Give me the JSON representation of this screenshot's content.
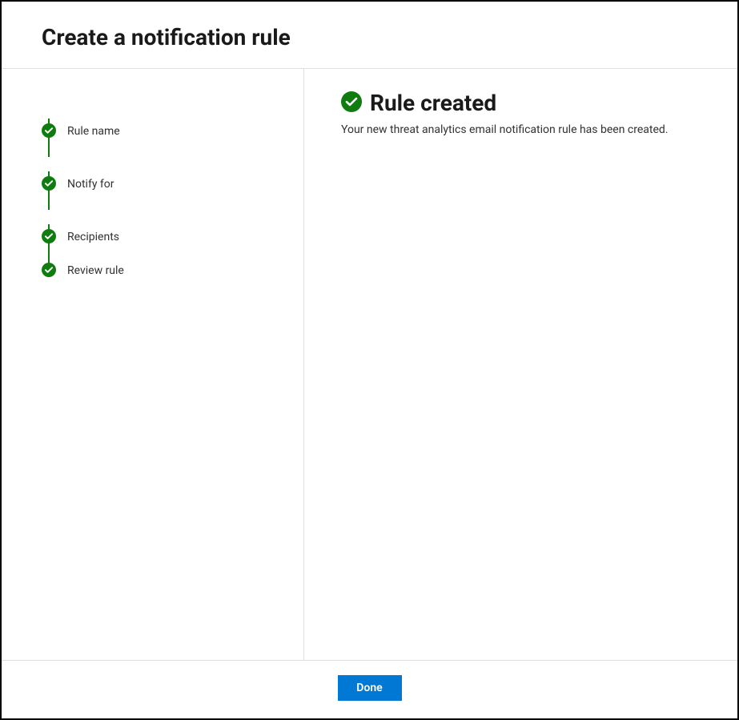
{
  "header": {
    "title": "Create a notification rule"
  },
  "sidebar": {
    "steps": [
      {
        "label": "Rule name"
      },
      {
        "label": "Notify for"
      },
      {
        "label": "Recipients"
      },
      {
        "label": "Review rule"
      }
    ]
  },
  "main": {
    "success_title": "Rule created",
    "success_description": "Your new threat analytics email notification rule has been created."
  },
  "footer": {
    "done_label": "Done"
  },
  "colors": {
    "success_green": "#107c10",
    "primary_blue": "#0078d4"
  }
}
